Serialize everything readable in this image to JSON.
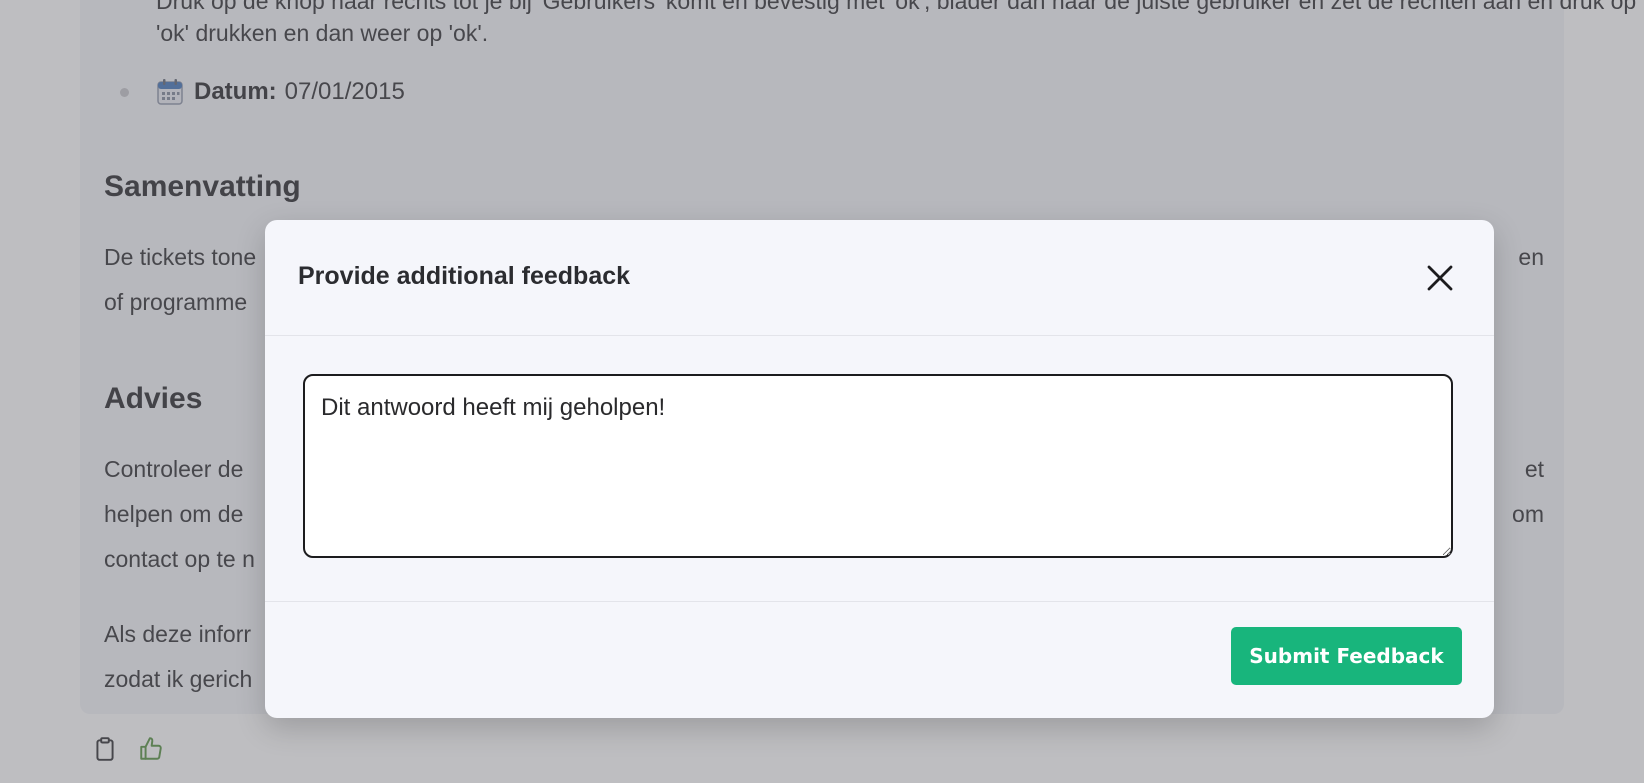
{
  "background": {
    "bullet_partial_line": "'ok' drukken en dan weer op 'ok'.",
    "bullet_cut_top": "Druk op de knop naar rechts tot je bij 'Gebruikers' komt en bevestig met 'ok', blader dan naar de juiste gebruiker en zet de rechten aan en druk op",
    "date_label": "Datum:",
    "date_value": "07/01/2015",
    "heading_summary": "Samenvatting",
    "summary_line1_start": "De tickets tone",
    "summary_line1_end": "en",
    "summary_line2_start": "of programme",
    "heading_advice": "Advies",
    "advice_line1_start": "Controleer de",
    "advice_line1_end": "et",
    "advice_line2_start": "helpen om de",
    "advice_line2_end": "om",
    "advice_line3_start": "contact op te n",
    "closing_line1_start": "Als deze inforr",
    "closing_line2_start": "zodat ik gerich"
  },
  "modal": {
    "title": "Provide additional feedback",
    "feedback_value": "Dit antwoord heeft mij geholpen!",
    "submit_label": "Submit Feedback"
  },
  "icons": {
    "calendar": "calendar-icon",
    "close": "close-icon",
    "clipboard": "clipboard-icon",
    "thumbs_up": "thumbs-up-icon"
  },
  "colors": {
    "submit_bg": "#18b57c",
    "thumbs_up": "#4f8f3a",
    "overlay": "rgba(110,110,118,0.45)"
  }
}
